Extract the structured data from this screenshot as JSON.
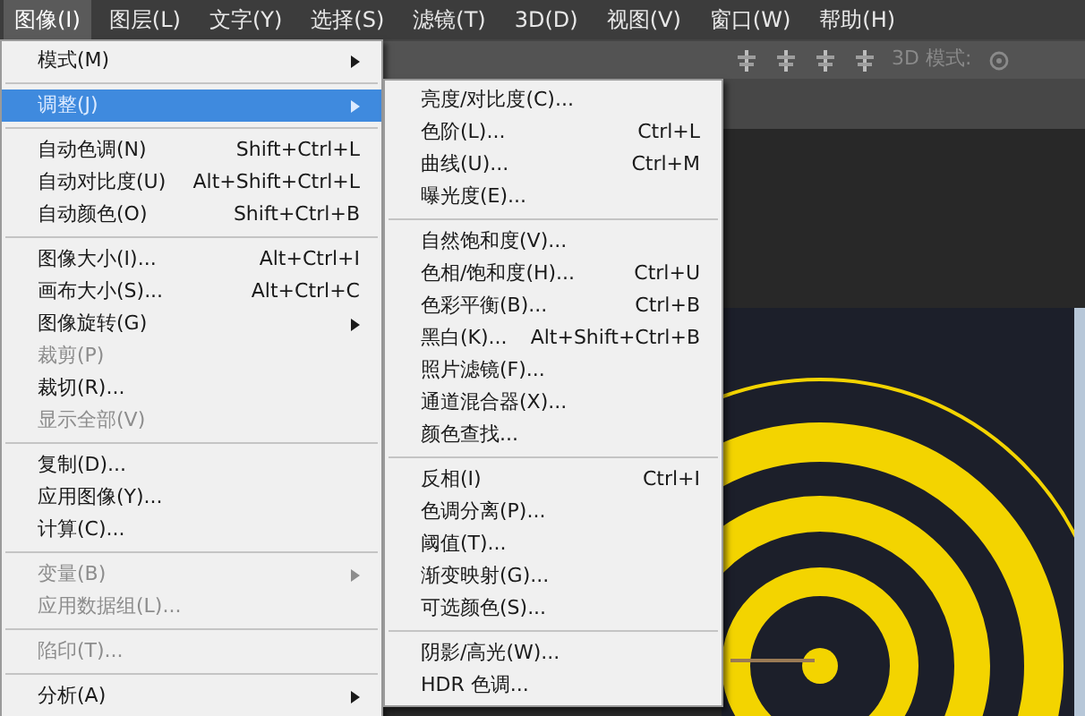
{
  "menubar": [
    {
      "label": "图像(I)",
      "selected": true
    },
    {
      "label": "图层(L)",
      "selected": false
    },
    {
      "label": "文字(Y)",
      "selected": false
    },
    {
      "label": "选择(S)",
      "selected": false
    },
    {
      "label": "滤镜(T)",
      "selected": false
    },
    {
      "label": "3D(D)",
      "selected": false
    },
    {
      "label": "视图(V)",
      "selected": false
    },
    {
      "label": "窗口(W)",
      "selected": false
    },
    {
      "label": "帮助(H)",
      "selected": false
    }
  ],
  "toolbar": {
    "mode_label": "3D 模式:"
  },
  "image_menu": {
    "items": [
      {
        "kind": "item",
        "label": "模式(M)",
        "submenu": true,
        "disabled": false,
        "selected": false
      },
      {
        "kind": "separator"
      },
      {
        "kind": "item",
        "label": "调整(J)",
        "submenu": true,
        "disabled": false,
        "selected": true
      },
      {
        "kind": "separator"
      },
      {
        "kind": "item",
        "label": "自动色调(N)",
        "shortcut": "Shift+Ctrl+L",
        "submenu": false,
        "disabled": false,
        "selected": false
      },
      {
        "kind": "item",
        "label": "自动对比度(U)",
        "shortcut": "Alt+Shift+Ctrl+L",
        "submenu": false,
        "disabled": false,
        "selected": false
      },
      {
        "kind": "item",
        "label": "自动颜色(O)",
        "shortcut": "Shift+Ctrl+B",
        "submenu": false,
        "disabled": false,
        "selected": false
      },
      {
        "kind": "separator"
      },
      {
        "kind": "item",
        "label": "图像大小(I)...",
        "shortcut": "Alt+Ctrl+I",
        "submenu": false,
        "disabled": false,
        "selected": false
      },
      {
        "kind": "item",
        "label": "画布大小(S)...",
        "shortcut": "Alt+Ctrl+C",
        "submenu": false,
        "disabled": false,
        "selected": false
      },
      {
        "kind": "item",
        "label": "图像旋转(G)",
        "submenu": true,
        "disabled": false,
        "selected": false
      },
      {
        "kind": "item",
        "label": "裁剪(P)",
        "submenu": false,
        "disabled": true,
        "selected": false
      },
      {
        "kind": "item",
        "label": "裁切(R)...",
        "submenu": false,
        "disabled": false,
        "selected": false
      },
      {
        "kind": "item",
        "label": "显示全部(V)",
        "submenu": false,
        "disabled": true,
        "selected": false
      },
      {
        "kind": "separator"
      },
      {
        "kind": "item",
        "label": "复制(D)...",
        "submenu": false,
        "disabled": false,
        "selected": false
      },
      {
        "kind": "item",
        "label": "应用图像(Y)...",
        "submenu": false,
        "disabled": false,
        "selected": false
      },
      {
        "kind": "item",
        "label": "计算(C)...",
        "submenu": false,
        "disabled": false,
        "selected": false
      },
      {
        "kind": "separator"
      },
      {
        "kind": "item",
        "label": "变量(B)",
        "submenu": true,
        "disabled": true,
        "selected": false
      },
      {
        "kind": "item",
        "label": "应用数据组(L)...",
        "submenu": false,
        "disabled": true,
        "selected": false
      },
      {
        "kind": "separator"
      },
      {
        "kind": "item",
        "label": "陷印(T)...",
        "submenu": false,
        "disabled": true,
        "selected": false
      },
      {
        "kind": "separator"
      },
      {
        "kind": "item",
        "label": "分析(A)",
        "submenu": true,
        "disabled": false,
        "selected": false
      }
    ]
  },
  "adjust_submenu": {
    "items": [
      {
        "kind": "item",
        "label": "亮度/对比度(C)...",
        "selected": false
      },
      {
        "kind": "item",
        "label": "色阶(L)...",
        "shortcut": "Ctrl+L",
        "selected": false
      },
      {
        "kind": "item",
        "label": "曲线(U)...",
        "shortcut": "Ctrl+M",
        "selected": false
      },
      {
        "kind": "item",
        "label": "曝光度(E)...",
        "selected": false
      },
      {
        "kind": "separator"
      },
      {
        "kind": "item",
        "label": "自然饱和度(V)...",
        "selected": false
      },
      {
        "kind": "item",
        "label": "色相/饱和度(H)...",
        "shortcut": "Ctrl+U",
        "selected": false
      },
      {
        "kind": "item",
        "label": "色彩平衡(B)...",
        "shortcut": "Ctrl+B",
        "selected": false
      },
      {
        "kind": "item",
        "label": "黑白(K)...",
        "shortcut": "Alt+Shift+Ctrl+B",
        "selected": false
      },
      {
        "kind": "item",
        "label": "照片滤镜(F)...",
        "selected": false
      },
      {
        "kind": "item",
        "label": "通道混合器(X)...",
        "selected": false
      },
      {
        "kind": "item",
        "label": "颜色查找...",
        "selected": false
      },
      {
        "kind": "separator"
      },
      {
        "kind": "item",
        "label": "反相(I)",
        "shortcut": "Ctrl+I",
        "selected": false
      },
      {
        "kind": "item",
        "label": "色调分离(P)...",
        "selected": false
      },
      {
        "kind": "item",
        "label": "阈值(T)...",
        "selected": false
      },
      {
        "kind": "item",
        "label": "渐变映射(G)...",
        "selected": false
      },
      {
        "kind": "item",
        "label": "可选颜色(S)...",
        "selected": false
      },
      {
        "kind": "separator"
      },
      {
        "kind": "item",
        "label": "阴影/高光(W)...",
        "selected": false
      },
      {
        "kind": "item",
        "label": "HDR 色调...",
        "selected": false
      }
    ]
  }
}
